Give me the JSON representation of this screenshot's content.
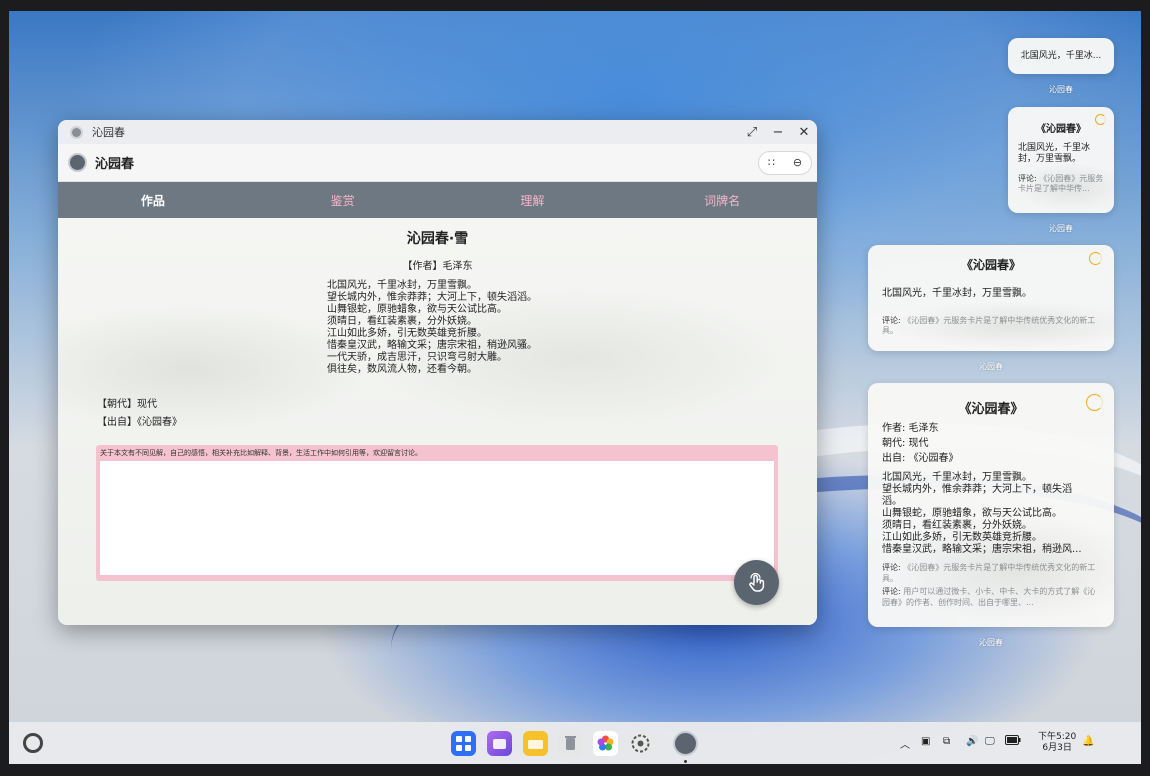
{
  "window": {
    "title": "沁园春",
    "app_name": "沁园春",
    "tabs": [
      {
        "label": "作品"
      },
      {
        "label": "鉴赏"
      },
      {
        "label": "理解"
      },
      {
        "label": "词牌名"
      }
    ],
    "poem": {
      "title": "沁园春·雪",
      "author": "【作者】毛泽东",
      "lines": [
        "北国风光，千里冰封，万里雪飘。",
        "望长城内外，惟余莽莽；大河上下，顿失滔滔。",
        "山舞银蛇，原驰蜡象，欲与天公试比高。",
        "须晴日，看红装素裹，分外妖娆。",
        "江山如此多娇，引无数英雄竞折腰。",
        "惜秦皇汉武，略输文采；唐宗宋祖，稍逊风骚。",
        "一代天骄，成吉思汗，只识弯弓射大雕。",
        "俱往矣，数风流人物，还看今朝。"
      ],
      "dynasty": "【朝代】现代",
      "source": "【出自】《沁园春》"
    },
    "comment": {
      "hint": "关于本文有不同见解，自己的感悟，相关补充比如解释、背景，生活工作中如何引用等，欢迎留言讨论。",
      "value": ""
    }
  },
  "widgets": {
    "micro": {
      "text": "北国风光，千里冰...",
      "label": "沁园春"
    },
    "small": {
      "title": "《沁园春》",
      "text": "北国风光，千里冰封，万里雪飘。",
      "comment_prefix": "评论:",
      "comment": "《沁园春》元服务卡片是了解中华传...",
      "label": "沁园春"
    },
    "medium": {
      "title": "《沁园春》",
      "text": "北国风光，千里冰封，万里雪飘。",
      "comment_prefix": "评论:",
      "comment": "《沁园春》元服务卡片是了解中华传统优秀文化的新工具。",
      "label": "沁园春"
    },
    "large": {
      "title": "《沁园春》",
      "author": "作者:  毛泽东",
      "dynasty": "朝代:  现代",
      "source": "出自:  《沁园春》",
      "lines": [
        "北国风光，千里冰封，万里雪飘。",
        "望长城内外，惟余莽莽；大河上下，顿失滔",
        "滔。",
        "山舞银蛇，原驰蜡象，欲与天公试比高。",
        "须晴日，看红装素裹，分外妖娆。",
        "江山如此多娇，引无数英雄竞折腰。",
        "惜秦皇汉武，略输文采；唐宗宋祖，稍逊风..."
      ],
      "comment_prefix": "评论:",
      "comment1": "《沁园春》元服务卡片是了解中华传统优秀文化的新工具。",
      "comment2": "用户可以通过微卡、小卡、中卡、大卡的方式了解《沁园春》的作者、创作时间、出自于哪里、...",
      "label": "沁园春"
    }
  },
  "taskbar": {
    "clock_time": "下午5:20",
    "clock_date": "6月3日"
  }
}
